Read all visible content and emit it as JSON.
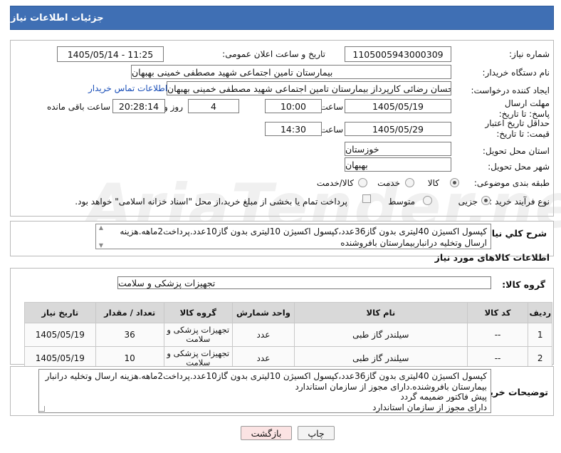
{
  "page_title": "جزئیات اطلاعات نیاز",
  "watermark": "AriaTender.net",
  "labels": {
    "need_number": "شماره نیاز:",
    "announce_datetime": "تاریخ و ساعت اعلان عمومی:",
    "buyer_org": "نام دستگاه خریدار:",
    "requester": "ایجاد کننده درخواست:",
    "send_deadline": "مهلت ارسال پاسخ: تا تاریخ:",
    "price_validity": "حداقل تاریخ اعتبار قیمت: تا تاریخ:",
    "time": "ساعت",
    "day_and": "روز و",
    "remaining": "ساعت باقی مانده",
    "province": "استان محل تحویل:",
    "city": "شهر محل تحویل:",
    "category": "طبقه بندی موضوعی:",
    "process_type": "نوع فرآیند خرید :",
    "description": "شرح کلي نياز:",
    "goods_info": "اطلاعات کالاهای مورد نیاز",
    "goods_group": "گروه کالا:",
    "buyer_notes": "توضیحات خریدار:"
  },
  "fields": {
    "need_number": "1105005943000309",
    "announce_datetime": "1405/05/14 - 11:25",
    "buyer_org": "بیمارستان تامین اجتماعی شهید مصطفی خمینی بهبهان",
    "requester": "احسان رضائی کارپرداز بیمارستان تامین اجتماعی شهید مصطفی خمینی بهبهان",
    "contact_link": "اطلاعات تماس خریدار",
    "send_date": "1405/05/19",
    "send_time": "10:00",
    "days": "4",
    "remaining_time": "20:28:14",
    "validity_date": "1405/05/29",
    "validity_time": "14:30",
    "province": "خوزستان",
    "city": "بهبهان",
    "goods_group": "تجهیزات پزشکی و سلامت"
  },
  "category_options": [
    {
      "label": "کالا",
      "selected": true
    },
    {
      "label": "خدمت",
      "selected": false
    },
    {
      "label": "کالا/خدمت",
      "selected": false
    }
  ],
  "process_options": [
    {
      "label": "جزیی",
      "selected": true
    },
    {
      "label": "متوسط",
      "selected": false
    }
  ],
  "payment_note": "پرداخت تمام یا بخشی از مبلغ خرید،از محل \"اسناد خزانه اسلامی\" خواهد بود.",
  "description": {
    "line1": "کپسول اکسیژن 40لیتری بدون گاز36عدد،کپسول اکسیژن 10لیتری بدون گاز10عدد.پرداخت2ماهه.هزینه",
    "line2": "ارسال وتخلیه درانباربیمارستان بافروشنده"
  },
  "table": {
    "headers": [
      "ردیف",
      "کد کالا",
      "نام کالا",
      "واحد شمارش",
      "گروه کالا",
      "تعداد / مقدار",
      "تاریخ نیاز"
    ],
    "rows": [
      {
        "idx": "1",
        "code": "--",
        "name": "سیلندر گاز طبی",
        "unit": "عدد",
        "group1": "تجهیزات پزشکی و",
        "group2": "سلامت",
        "qty": "36",
        "date": "1405/05/19"
      },
      {
        "idx": "2",
        "code": "--",
        "name": "سیلندر گاز طبی",
        "unit": "عدد",
        "group1": "تجهیزات پزشکی و",
        "group2": "سلامت",
        "qty": "10",
        "date": "1405/05/19"
      }
    ]
  },
  "buyer_notes": {
    "line1": "کپسول اکسیژن 40لیتری بدون گاز36عدد،کپسول اکسیژن 10لیتری بدون گاز10عدد.پرداخت2ماهه.هزینه ارسال وتخلیه درانبار",
    "line2": "بیمارستان بافروشنده.دارای مجوز از سازمان استاندارد",
    "line3": "پیش فاکتور ضمیمه گردد",
    "line4": "دارای مجوز از سازمان استاندارد"
  },
  "buttons": {
    "print": "چاپ",
    "back": "بازگشت"
  },
  "colors": {
    "header_bg": "#3f6fb4",
    "link": "#1a4fb8",
    "back_button_bg": "#fbe3e3"
  }
}
